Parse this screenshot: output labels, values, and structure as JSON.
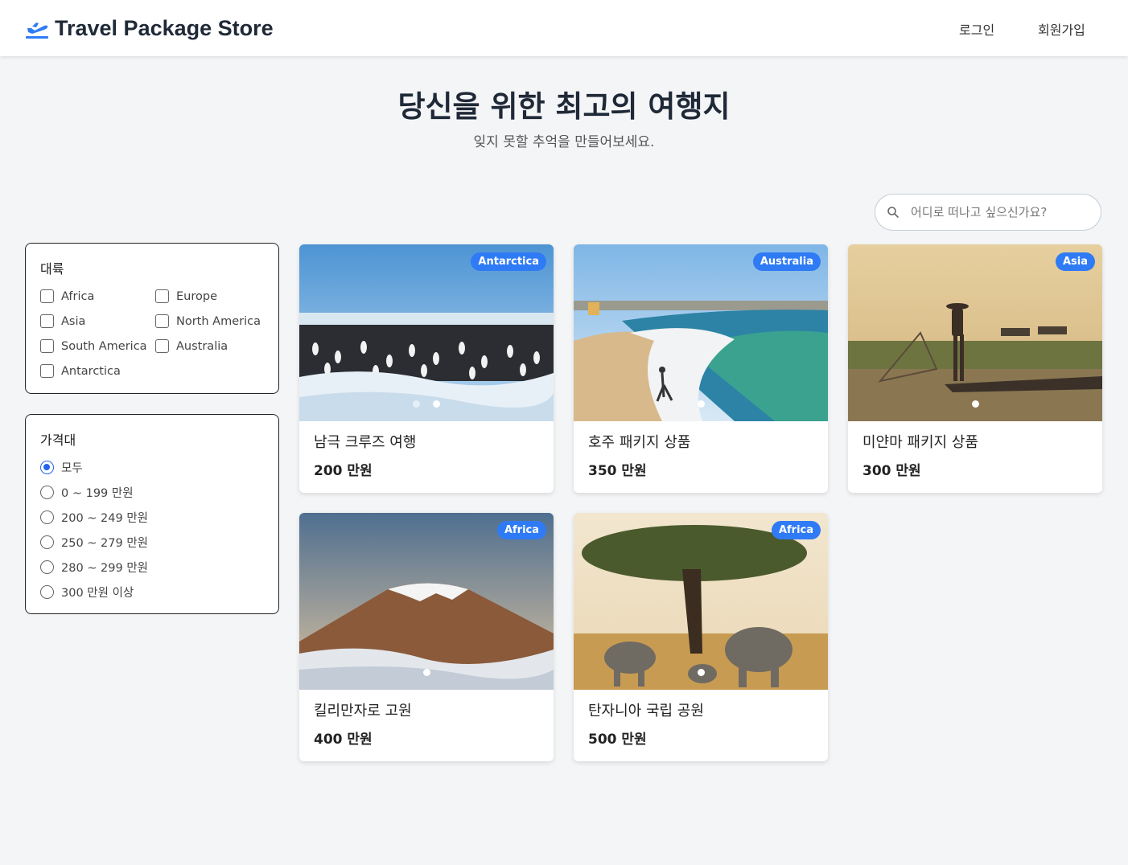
{
  "header": {
    "logo_text": "Travel Package Store",
    "login": "로그인",
    "signup": "회원가입"
  },
  "hero": {
    "title": "당신을 위한 최고의 여행지",
    "subtitle": "잊지 못할 추억을 만들어보세요."
  },
  "search": {
    "placeholder": "어디로 떠나고 싶으신가요?",
    "icon": "search-icon"
  },
  "filters": {
    "continent_title": "대륙",
    "continents": [
      "Africa",
      "Europe",
      "Asia",
      "North America",
      "South America",
      "Australia",
      "Antarctica"
    ],
    "price_title": "가격대",
    "price_options": [
      "모두",
      "0 ~ 199 만원",
      "200 ~ 249 만원",
      "250 ~ 279 만원",
      "280 ~ 299 만원",
      "300 만원 이상"
    ],
    "price_selected": "모두"
  },
  "products": [
    {
      "title": "남극 크루즈 여행",
      "price": "200 만원",
      "continent": "Antarctica",
      "image": "penguin colony on ice"
    },
    {
      "title": "호주 패키지 상품",
      "price": "350 만원",
      "continent": "Australia",
      "image": "surf beach"
    },
    {
      "title": "미얀마 패키지 상품",
      "price": "300 만원",
      "continent": "Asia",
      "image": "fisherman on lake"
    },
    {
      "title": "킬리만자로 고원",
      "price": "400 만원",
      "continent": "Africa",
      "image": "snow-capped mountain above clouds"
    },
    {
      "title": "탄자니아 국립 공원",
      "price": "500 만원",
      "continent": "Africa",
      "image": "acacia tree with elephants"
    }
  ],
  "colors": {
    "accent": "#2f7bf5",
    "radio_selected": "#2563eb",
    "background": "#f4f5f7"
  }
}
